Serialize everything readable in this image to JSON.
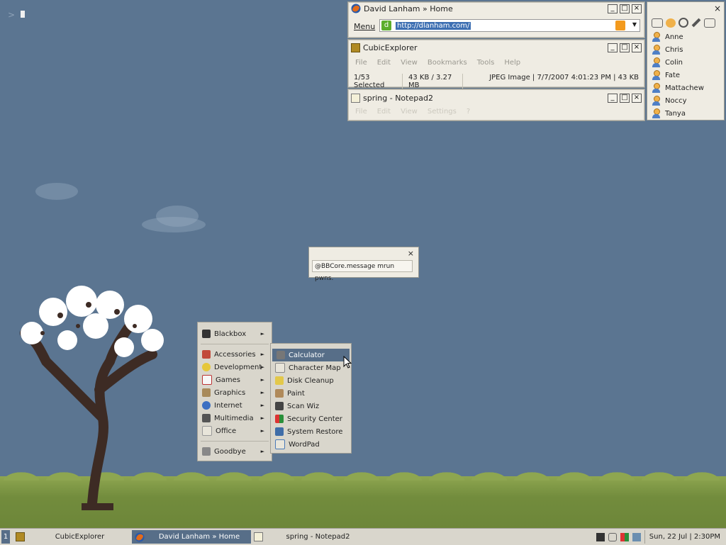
{
  "console": {
    "prompt": ">"
  },
  "browser": {
    "title": "David Lanham » Home",
    "menu_label": "Menu",
    "url": "http://dlanham.com/"
  },
  "explorer": {
    "title": "CubicExplorer",
    "menus": [
      "File",
      "Edit",
      "View",
      "Bookmarks",
      "Tools",
      "Help"
    ],
    "status": {
      "selected": "1/53 Selected",
      "sizes": "43 KB / 3.27 MB",
      "info": "JPEG Image | 7/7/2007 4:01:23 PM | 43 KB"
    }
  },
  "notepad": {
    "title": "spring - Notepad2",
    "menus": [
      "File",
      "Edit",
      "View",
      "Settings",
      "?"
    ]
  },
  "roster": {
    "contacts": [
      "Anne",
      "Chris",
      "Colin",
      "Fate",
      "Mattachew",
      "Noccy",
      "Tanya"
    ]
  },
  "message": {
    "text": "@BBCore.message mrun pwns."
  },
  "start_menu": {
    "top": "Blackbox",
    "items": [
      "Accessories",
      "Development",
      "Games",
      "Graphics",
      "Internet",
      "Multimedia",
      "Office"
    ],
    "bottom": "Goodbye"
  },
  "submenu": {
    "items": [
      "Calculator",
      "Character Map",
      "Disk Cleanup",
      "Paint",
      "Scan Wiz",
      "Security Center",
      "System Restore",
      "WordPad"
    ]
  },
  "taskbar": {
    "workspace": "1",
    "tasks": [
      "CubicExplorer",
      "David Lanham » Home",
      "spring - Notepad2"
    ],
    "clock": "Sun, 22 Jul | 2:30PM"
  },
  "colors": {
    "desktop": "#5b7591",
    "highlight": "#576e88",
    "panel": "#efece3"
  }
}
